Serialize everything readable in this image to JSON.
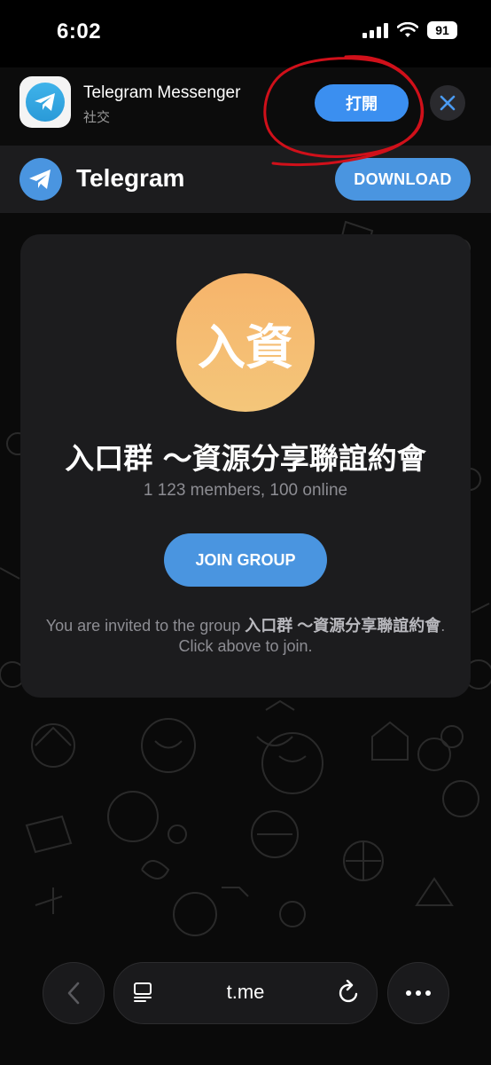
{
  "status_bar": {
    "time": "6:02",
    "battery": "91"
  },
  "app_banner": {
    "app_name": "Telegram Messenger",
    "category": "社交",
    "open_label": "打開"
  },
  "header": {
    "brand": "Telegram",
    "download_label": "DOWNLOAD"
  },
  "group": {
    "avatar_text": "入資",
    "title": "入口群 ～資源分享聯誼約會",
    "members": "1 123 members, 100 online",
    "join_label": "JOIN GROUP",
    "invite_prefix": "You are invited to the group ",
    "invite_group": "入口群 ～資源分享聯誼約會",
    "invite_suffix": ". Click above to join."
  },
  "browser": {
    "url": "t.me"
  },
  "colors": {
    "accent": "#4a95e0",
    "open_button": "#3b8ff0",
    "avatar_top": "#f6b46b",
    "avatar_bottom": "#f4c67a",
    "annotation": "#d0101a"
  },
  "icons": [
    "telegram-logo-icon",
    "close-icon",
    "cellular-signal-icon",
    "wifi-icon",
    "back-chevron-icon",
    "tabs-icon",
    "reload-icon",
    "more-icon"
  ]
}
